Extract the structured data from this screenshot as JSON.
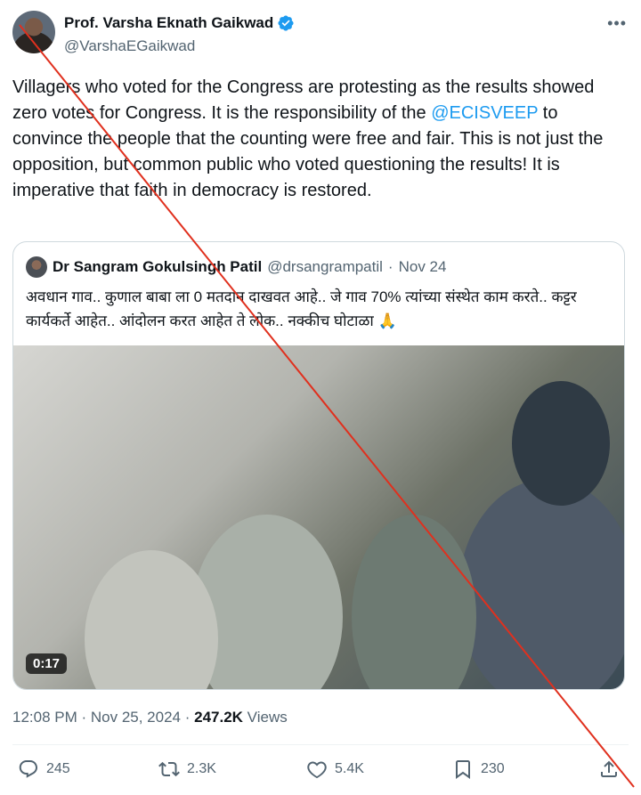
{
  "author": {
    "name": "Prof. Varsha Eknath Gaikwad",
    "handle": "@VarshaEGaikwad"
  },
  "tweet": {
    "text_before": "Villagers who voted for the Congress are protesting as the results showed zero votes for Congress. It is the responsibility of the ",
    "mention": "@ECISVEEP",
    "text_after": " to convince the people that the counting were free and fair. This is not just the opposition, but common public who voted questioning the results! It is imperative that faith in democracy is restored."
  },
  "quote": {
    "name": "Dr Sangram Gokulsingh Patil",
    "handle": "@drsangrampatil",
    "separator": "·",
    "date": "Nov 24",
    "text": "अवधान गाव.. कुणाल बाबा ला 0 मतदान दाखवत आहे.. जे गाव 70% त्यांच्या संस्थेत काम करते.. कट्टर कार्यकर्ते आहेत.. आंदोलन करत आहेत ते लोक.. नक्कीच घोटाळा 🙏",
    "video_duration": "0:17"
  },
  "meta": {
    "time": "12:08 PM",
    "separator1": " · ",
    "date": "Nov 25, 2024",
    "separator2": " · ",
    "views_count": "247.2K",
    "views_label": " Views"
  },
  "actions": {
    "replies": "245",
    "reposts": "2.3K",
    "likes": "5.4K",
    "bookmarks": "230"
  },
  "icons": {
    "verified": "verified-badge-icon",
    "more": "more-icon",
    "reply": "reply-icon",
    "repost": "repost-icon",
    "like": "heart-icon",
    "bookmark": "bookmark-icon",
    "share": "share-icon"
  },
  "colors": {
    "accent": "#1d9bf0",
    "secondary_text": "#536471",
    "overlay_cross": "#e0301e"
  }
}
